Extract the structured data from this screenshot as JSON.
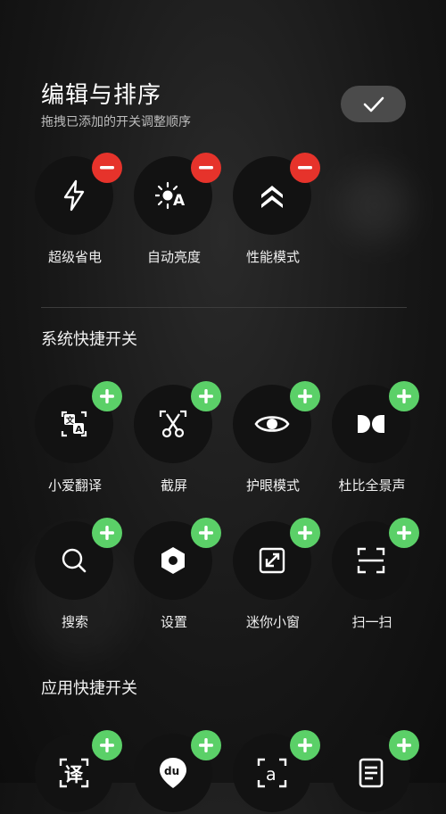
{
  "header": {
    "title": "编辑与排序",
    "subtitle": "拖拽已添加的开关调整顺序",
    "done_icon": "checkmark-icon"
  },
  "colors": {
    "remove_badge": "#e6332b",
    "add_badge": "#5bd068",
    "tile_bg": "#121212"
  },
  "added": [
    {
      "label": "超级省电",
      "icon": "lightning-icon"
    },
    {
      "label": "自动亮度",
      "icon": "sun-auto-icon"
    },
    {
      "label": "性能模式",
      "icon": "double-chevron-up-icon"
    }
  ],
  "system_section": {
    "title": "系统快捷开关",
    "items": [
      {
        "label": "小爱翻译",
        "icon": "translate-icon"
      },
      {
        "label": "截屏",
        "icon": "scissors-icon"
      },
      {
        "label": "护眼模式",
        "icon": "eye-icon"
      },
      {
        "label": "杜比全景声",
        "icon": "dolby-icon"
      },
      {
        "label": "搜索",
        "icon": "search-icon"
      },
      {
        "label": "设置",
        "icon": "settings-icon"
      },
      {
        "label": "迷你小窗",
        "icon": "mini-window-icon"
      },
      {
        "label": "扫一扫",
        "icon": "scan-icon"
      }
    ]
  },
  "app_section": {
    "title": "应用快捷开关",
    "items": [
      {
        "icon": "app-translate-icon",
        "glyph": "译"
      },
      {
        "icon": "baidu-map-icon",
        "glyph": "du"
      },
      {
        "icon": "text-recognize-icon",
        "glyph": "a"
      },
      {
        "icon": "notes-icon"
      }
    ]
  }
}
